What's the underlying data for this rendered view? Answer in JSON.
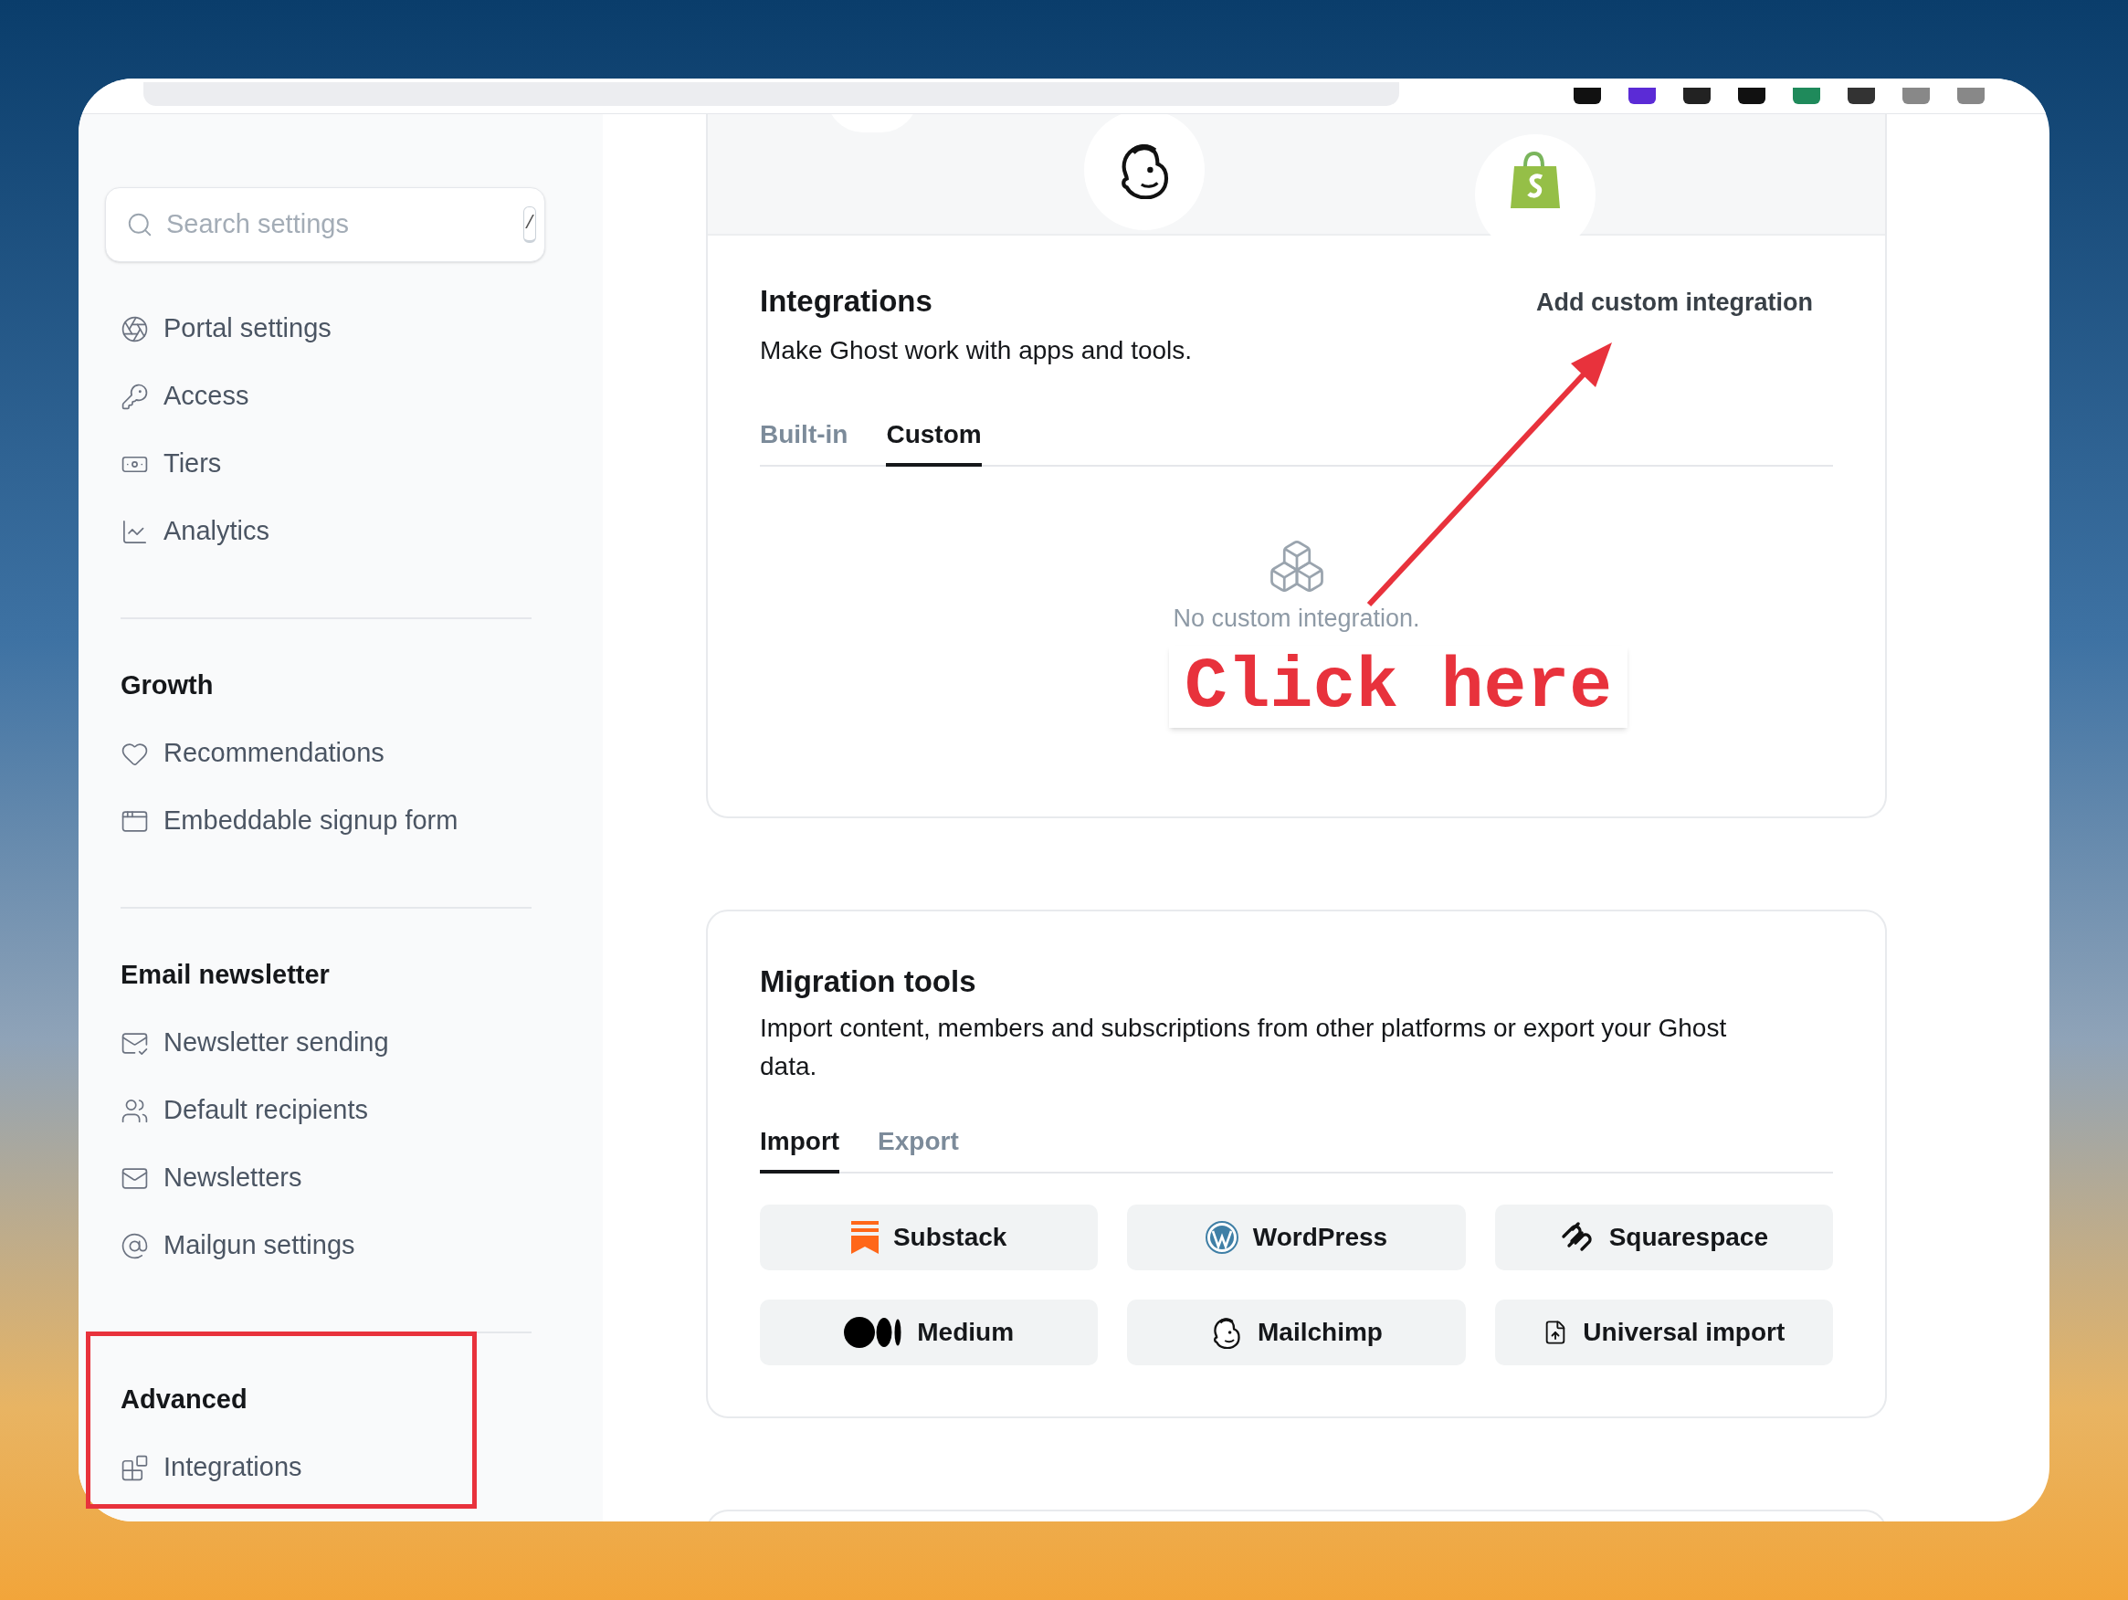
{
  "sidebar": {
    "search": {
      "placeholder": "Search settings",
      "shortcut": "/"
    },
    "sections": [
      {
        "items": [
          "Portal settings",
          "Access",
          "Tiers",
          "Analytics"
        ]
      },
      {
        "heading": "Growth",
        "items": [
          "Recommendations",
          "Embeddable signup form"
        ]
      },
      {
        "heading": "Email newsletter",
        "items": [
          "Newsletter sending",
          "Default recipients",
          "Newsletters",
          "Mailgun settings"
        ]
      },
      {
        "heading": "Advanced",
        "items": [
          "Integrations"
        ]
      }
    ]
  },
  "integrations": {
    "title": "Integrations",
    "description": "Make Ghost work with apps and tools.",
    "action": "Add custom integration",
    "tabs": [
      {
        "label": "Built-in",
        "selected": false
      },
      {
        "label": "Custom",
        "selected": true
      }
    ],
    "empty_state": "No custom integration."
  },
  "migration": {
    "title": "Migration tools",
    "description": "Import content, members and subscriptions from other platforms or export your Ghost data.",
    "tabs": [
      {
        "label": "Import",
        "selected": true
      },
      {
        "label": "Export",
        "selected": false
      }
    ],
    "buttons": [
      "Substack",
      "WordPress",
      "Squarespace",
      "Medium",
      "Mailchimp",
      "Universal import"
    ]
  },
  "annotation": {
    "callout": "Click here"
  }
}
